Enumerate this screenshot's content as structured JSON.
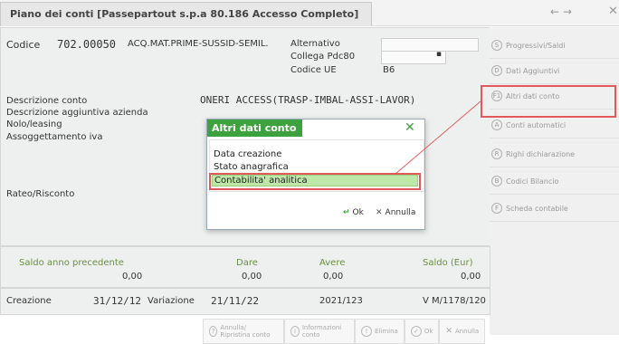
{
  "window": {
    "title": "Piano dei conti [Passepartout s.p.a 80.186 Accesso Completo]",
    "nav_icon": "back-forward-arrows-icon",
    "close_icon": "close-icon"
  },
  "header": {
    "codice_label": "Codice",
    "codice_value": "702.00050",
    "codice_desc": "ACQ.MAT.PRIME-SUSSID-SEMIL.",
    "alternativo_label": "Alternativo",
    "collega_label": "Collega Pdc80",
    "codice_ue_label": "Codice UE",
    "codice_ue_value": "B6"
  },
  "fields": {
    "descrizione_label": "Descrizione conto",
    "descrizione_value": "ONERI ACCESS(TRASP-IMBAL-ASSI-LAVOR)",
    "descr_agg_label": "Descrizione aggiuntiva azienda",
    "nolo_label": "Nolo/leasing",
    "assoggettamento_label": "Assoggettamento iva",
    "rateo_label": "Rateo/Risconto"
  },
  "sidebar": {
    "items": [
      {
        "label": "Progressivi/Saldi",
        "key": "S"
      },
      {
        "label": "Dati Aggiuntivi",
        "key": "D"
      },
      {
        "label": "Altri dati conto",
        "key": "F1"
      },
      {
        "label": "Conti automatici",
        "key": "A"
      },
      {
        "label": "Righi dichiarazione",
        "key": "R"
      },
      {
        "label": "Codici Bilancio",
        "key": "B"
      },
      {
        "label": "Scheda contabile",
        "key": "F"
      }
    ]
  },
  "totals": {
    "saldo_prec_label": "Saldo anno precedente",
    "saldo_prec_value": "0,00",
    "dare_label": "Dare",
    "dare_value": "0,00",
    "avere_label": "Avere",
    "avere_value": "0,00",
    "saldo_label": "Saldo (Eur)",
    "saldo_value": "0,00"
  },
  "footer": {
    "creazione_label": "Creazione",
    "creazione_value": "31/12/12",
    "variazione_label": "Variazione",
    "variazione_value": "21/11/22",
    "code_1": "2021/123",
    "code_2": "V M/1178/120"
  },
  "buttons": [
    {
      "label": "Annulla/ Ripristina conto"
    },
    {
      "label": "Informazioni conto"
    },
    {
      "label": "Elimina"
    },
    {
      "label": "Ok"
    },
    {
      "label": "Annulla"
    }
  ],
  "dialog": {
    "title": "Altri dati conto",
    "items": [
      "Data creazione",
      "Stato anagrafica",
      "Contabilita' analitica"
    ],
    "ok_label": "Ok",
    "annulla_label": "Annulla"
  },
  "colors": {
    "accent_green": "#3da13d",
    "highlight_red": "#e05a5a",
    "selection_green": "#bde8a8"
  }
}
